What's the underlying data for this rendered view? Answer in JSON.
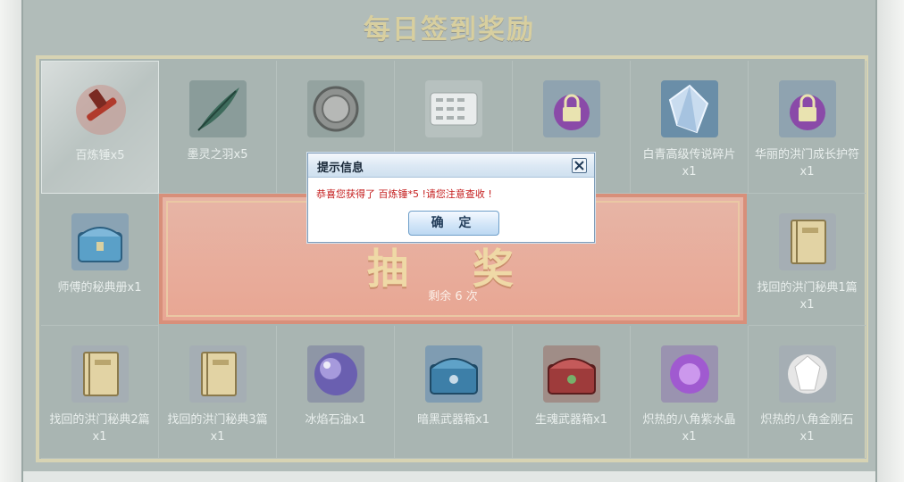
{
  "page": {
    "title": "每日签到奖励"
  },
  "rewards": [
    {
      "label": "百炼锤x5",
      "icon": "hammer-icon",
      "selected": true
    },
    {
      "label": "墨灵之羽x5",
      "icon": "feather-icon"
    },
    {
      "label": "",
      "icon": "coin-icon"
    },
    {
      "label": "",
      "icon": "scroll-icon"
    },
    {
      "label": "",
      "icon": "lock-charm-icon"
    },
    {
      "label": "白青高级传说碎片x1",
      "icon": "crystal-shard-icon"
    },
    {
      "label": "华丽的洪门成长护符x1",
      "icon": "lock-charm-icon"
    },
    {
      "label": "师傅的秘典册x1",
      "icon": "chest-icon"
    },
    {
      "label": "找回的洪门秘典1篇x1",
      "icon": "book-icon"
    },
    {
      "label": "找回的洪门秘典2篇x1",
      "icon": "book-icon"
    },
    {
      "label": "找回的洪门秘典3篇x1",
      "icon": "book-icon"
    },
    {
      "label": "冰焰石油x1",
      "icon": "orb-icon"
    },
    {
      "label": "暗黑武器箱x1",
      "icon": "chest-icon"
    },
    {
      "label": "生魂武器箱x1",
      "icon": "chest-icon"
    },
    {
      "label": "炽热的八角紫水晶x1",
      "icon": "purple-gem-icon"
    },
    {
      "label": "炽热的八角金刚石x1",
      "icon": "diamond-icon"
    }
  ],
  "draw": {
    "title": "抽 奖",
    "remaining": "剩余 6 次"
  },
  "dialog": {
    "title": "提示信息",
    "message": "恭喜您获得了 百炼锤*5 !请您注意查收 !",
    "confirm_label": "确 定"
  },
  "colors": {
    "panel": "#b1bcb9",
    "title_gold": "#d8cf9f",
    "draw_red": "#e8a693",
    "dialog_text": "#c41c1c"
  }
}
